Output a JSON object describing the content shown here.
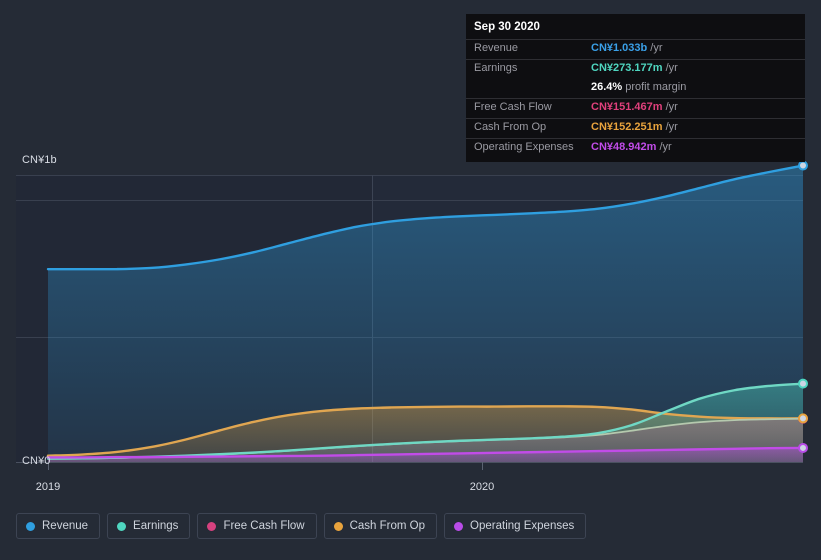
{
  "background_color": "#252b36",
  "axis": {
    "y_top_label": "CN¥1b",
    "y_zero_label": "CN¥0",
    "x_labels": [
      "2019",
      "2020"
    ]
  },
  "tooltip": {
    "date": "Sep 30 2020",
    "unit_suffix": "/yr",
    "rows": [
      {
        "key": "Revenue",
        "value": "CN¥1.033b",
        "unit": "/yr",
        "color": "#3aa0e8"
      },
      {
        "key": "Earnings",
        "value": "CN¥273.177m",
        "unit": "/yr",
        "color": "#4fd6c0"
      },
      {
        "key": "Free Cash Flow",
        "value": "CN¥151.467m",
        "unit": "/yr",
        "color": "#e0407c"
      },
      {
        "key": "Cash From Op",
        "value": "CN¥152.251m",
        "unit": "/yr",
        "color": "#e8a33d"
      },
      {
        "key": "Operating Expenses",
        "value": "CN¥48.942m",
        "unit": "/yr",
        "color": "#c14ce8"
      }
    ],
    "profit_margin": {
      "value": "26.4%",
      "label": "profit margin"
    }
  },
  "legend": {
    "items": [
      {
        "label": "Revenue",
        "color": "#2f9fe0"
      },
      {
        "label": "Earnings",
        "color": "#4fd6c0"
      },
      {
        "label": "Free Cash Flow",
        "color": "#d6417f"
      },
      {
        "label": "Cash From Op",
        "color": "#e8a33d"
      },
      {
        "label": "Operating Expenses",
        "color": "#b94ce8"
      }
    ]
  },
  "chart_data": {
    "type": "area",
    "title": "",
    "xlabel": "",
    "ylabel": "CN¥",
    "ylim": [
      0,
      1100000000
    ],
    "ytick_labels": [
      "CN¥0",
      "CN¥1b"
    ],
    "grid": true,
    "legend_position": "bottom",
    "currency": "CN¥",
    "period": "/yr",
    "x": [
      "2019",
      "2020",
      "Sep 30 2020"
    ],
    "xlim": [
      "2018-10",
      "2020-10"
    ],
    "forecast_divider_x": "2019-08",
    "series": [
      {
        "name": "Revenue",
        "color": "#2f9fe0",
        "end_value": 1033000000,
        "end_value_label": "CN¥1.033b",
        "values_b": [
          0.672,
          0.672,
          0.672,
          0.676,
          0.688,
          0.706,
          0.731,
          0.762,
          0.793,
          0.82,
          0.838,
          0.849,
          0.856,
          0.861,
          0.866,
          0.872,
          0.882,
          0.9,
          0.925,
          0.955,
          0.985,
          1.01,
          1.033
        ]
      },
      {
        "name": "Earnings",
        "color": "#4fd6c0",
        "end_value": 273177000,
        "end_value_label": "CN¥273.177m",
        "values_b": [
          0.012,
          0.013,
          0.015,
          0.018,
          0.022,
          0.027,
          0.033,
          0.04,
          0.048,
          0.056,
          0.063,
          0.069,
          0.074,
          0.078,
          0.082,
          0.088,
          0.1,
          0.128,
          0.175,
          0.221,
          0.25,
          0.265,
          0.273
        ]
      },
      {
        "name": "Free Cash Flow",
        "color": "#d6417f",
        "end_value": 151467000,
        "end_value_label": "CN¥151.467m",
        "values_b": [
          0.011,
          0.012,
          0.014,
          0.017,
          0.021,
          0.026,
          0.032,
          0.039,
          0.047,
          0.055,
          0.062,
          0.068,
          0.073,
          0.077,
          0.081,
          0.086,
          0.094,
          0.109,
          0.126,
          0.139,
          0.146,
          0.149,
          0.151
        ]
      },
      {
        "name": "Cash From Op",
        "color": "#e8a33d",
        "end_value": 152251000,
        "end_value_label": "CN¥152.251m",
        "values_b": [
          0.022,
          0.026,
          0.035,
          0.052,
          0.078,
          0.11,
          0.14,
          0.163,
          0.178,
          0.186,
          0.19,
          0.192,
          0.193,
          0.193,
          0.194,
          0.194,
          0.192,
          0.183,
          0.168,
          0.158,
          0.153,
          0.152,
          0.152
        ]
      },
      {
        "name": "Operating Expenses",
        "color": "#b94ce8",
        "end_value": 48942000,
        "end_value_label": "CN¥48.942m",
        "values_b": [
          0.016,
          0.016,
          0.017,
          0.017,
          0.018,
          0.019,
          0.02,
          0.021,
          0.022,
          0.024,
          0.026,
          0.028,
          0.03,
          0.032,
          0.034,
          0.036,
          0.038,
          0.04,
          0.042,
          0.044,
          0.046,
          0.048,
          0.049
        ]
      }
    ]
  }
}
